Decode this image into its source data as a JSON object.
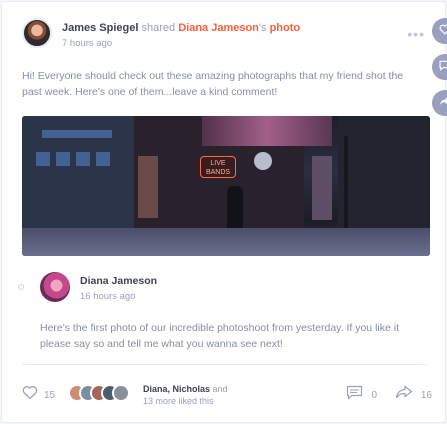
{
  "post": {
    "author": "James Spiegel",
    "action_word": "shared",
    "shared_from": "Diana Jameson",
    "possessive": "'s",
    "object": "photo",
    "time": "7 hours ago",
    "more_label": "•••",
    "text": "Hi! Everyone should check out these amazing photographs that my friend shot the past week. Here's one of them...leave a kind comment!",
    "photo_sign": "LIVE BANDS"
  },
  "comment": {
    "author": "Diana Jameson",
    "time": "16 hours ago",
    "text": "Here's the first photo of our incredible photoshoot from yesterday. If you like it please say so and tell me what you wanna see next!"
  },
  "footer": {
    "likes": "15",
    "liked_names": "Diana, Nicholas",
    "liked_and": "and",
    "liked_more": "13 more liked this",
    "comments": "0",
    "shares": "16"
  },
  "icons": {
    "like": "heart-icon",
    "comments": "speech-bubble-icon",
    "share": "share-arrow-icon",
    "side_like": "heart-icon",
    "side_comment": "speech-bubble-icon",
    "side_share": "share-arrow-icon"
  },
  "colors": {
    "accent": "#ff5e3a",
    "muted": "#9a9fbf",
    "text": "#3f4257"
  }
}
